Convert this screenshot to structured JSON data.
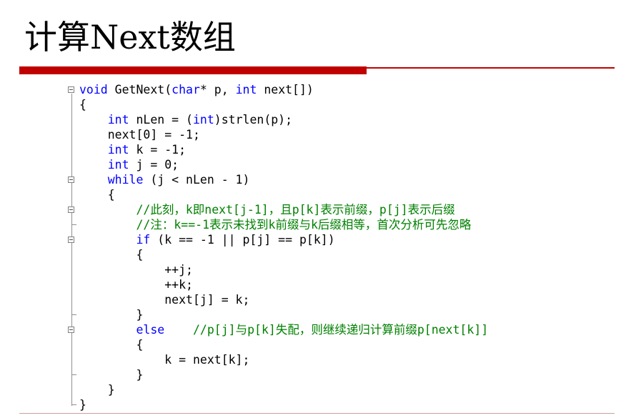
{
  "slide": {
    "title": "计算Next数组"
  },
  "code": {
    "lines": [
      {
        "indent": "",
        "segments": [
          {
            "t": "void",
            "k": "kw"
          },
          {
            "t": " GetNext(",
            "k": "pl"
          },
          {
            "t": "char",
            "k": "kw"
          },
          {
            "t": "* p, ",
            "k": "pl"
          },
          {
            "t": "int",
            "k": "kw"
          },
          {
            "t": " next[])",
            "k": "pl"
          }
        ]
      },
      {
        "indent": "",
        "segments": [
          {
            "t": "{",
            "k": "pl"
          }
        ]
      },
      {
        "indent": "    ",
        "segments": [
          {
            "t": "int",
            "k": "kw"
          },
          {
            "t": " nLen = (",
            "k": "pl"
          },
          {
            "t": "int",
            "k": "kw"
          },
          {
            "t": ")strlen(p);",
            "k": "pl"
          }
        ]
      },
      {
        "indent": "    ",
        "segments": [
          {
            "t": "next[0] = -1;",
            "k": "pl"
          }
        ]
      },
      {
        "indent": "    ",
        "segments": [
          {
            "t": "int",
            "k": "kw"
          },
          {
            "t": " k = -1;",
            "k": "pl"
          }
        ]
      },
      {
        "indent": "    ",
        "segments": [
          {
            "t": "int",
            "k": "kw"
          },
          {
            "t": " j = 0;",
            "k": "pl"
          }
        ]
      },
      {
        "indent": "    ",
        "segments": [
          {
            "t": "while",
            "k": "kw"
          },
          {
            "t": " (j < nLen - 1)",
            "k": "pl"
          }
        ]
      },
      {
        "indent": "    ",
        "segments": [
          {
            "t": "{",
            "k": "pl"
          }
        ]
      },
      {
        "indent": "        ",
        "segments": [
          {
            "t": "//此刻，k即next[j-1]，且p[k]表示前缀，p[j]表示后缀",
            "k": "cm"
          }
        ]
      },
      {
        "indent": "        ",
        "segments": [
          {
            "t": "//注：k==-1表示未找到k前缀与k后缀相等，首次分析可先忽略",
            "k": "cm"
          }
        ]
      },
      {
        "indent": "        ",
        "segments": [
          {
            "t": "if",
            "k": "kw"
          },
          {
            "t": " (k == -1 || p[j] == p[k])",
            "k": "pl"
          }
        ]
      },
      {
        "indent": "        ",
        "segments": [
          {
            "t": "{",
            "k": "pl"
          }
        ]
      },
      {
        "indent": "            ",
        "segments": [
          {
            "t": "++j;",
            "k": "pl"
          }
        ]
      },
      {
        "indent": "            ",
        "segments": [
          {
            "t": "++k;",
            "k": "pl"
          }
        ]
      },
      {
        "indent": "            ",
        "segments": [
          {
            "t": "next[j] = k;",
            "k": "pl"
          }
        ]
      },
      {
        "indent": "        ",
        "segments": [
          {
            "t": "}",
            "k": "pl"
          }
        ]
      },
      {
        "indent": "        ",
        "segments": [
          {
            "t": "else",
            "k": "kw"
          },
          {
            "t": "    ",
            "k": "pl"
          },
          {
            "t": "//p[j]与p[k]失配，则继续递归计算前缀p[next[k]]",
            "k": "cm"
          }
        ]
      },
      {
        "indent": "        ",
        "segments": [
          {
            "t": "{",
            "k": "pl"
          }
        ]
      },
      {
        "indent": "            ",
        "segments": [
          {
            "t": "k = next[k];",
            "k": "pl"
          }
        ]
      },
      {
        "indent": "        ",
        "segments": [
          {
            "t": "}",
            "k": "pl"
          }
        ]
      },
      {
        "indent": "    ",
        "segments": [
          {
            "t": "}",
            "k": "pl"
          }
        ]
      },
      {
        "indent": "",
        "segments": [
          {
            "t": "}",
            "k": "pl"
          }
        ]
      }
    ]
  },
  "colors": {
    "keyword": "#0000ff",
    "comment": "#008000",
    "plain": "#000000",
    "accent_red": "#c00000"
  },
  "icons": {
    "fold_toggle": "collapse-minus-icon"
  }
}
